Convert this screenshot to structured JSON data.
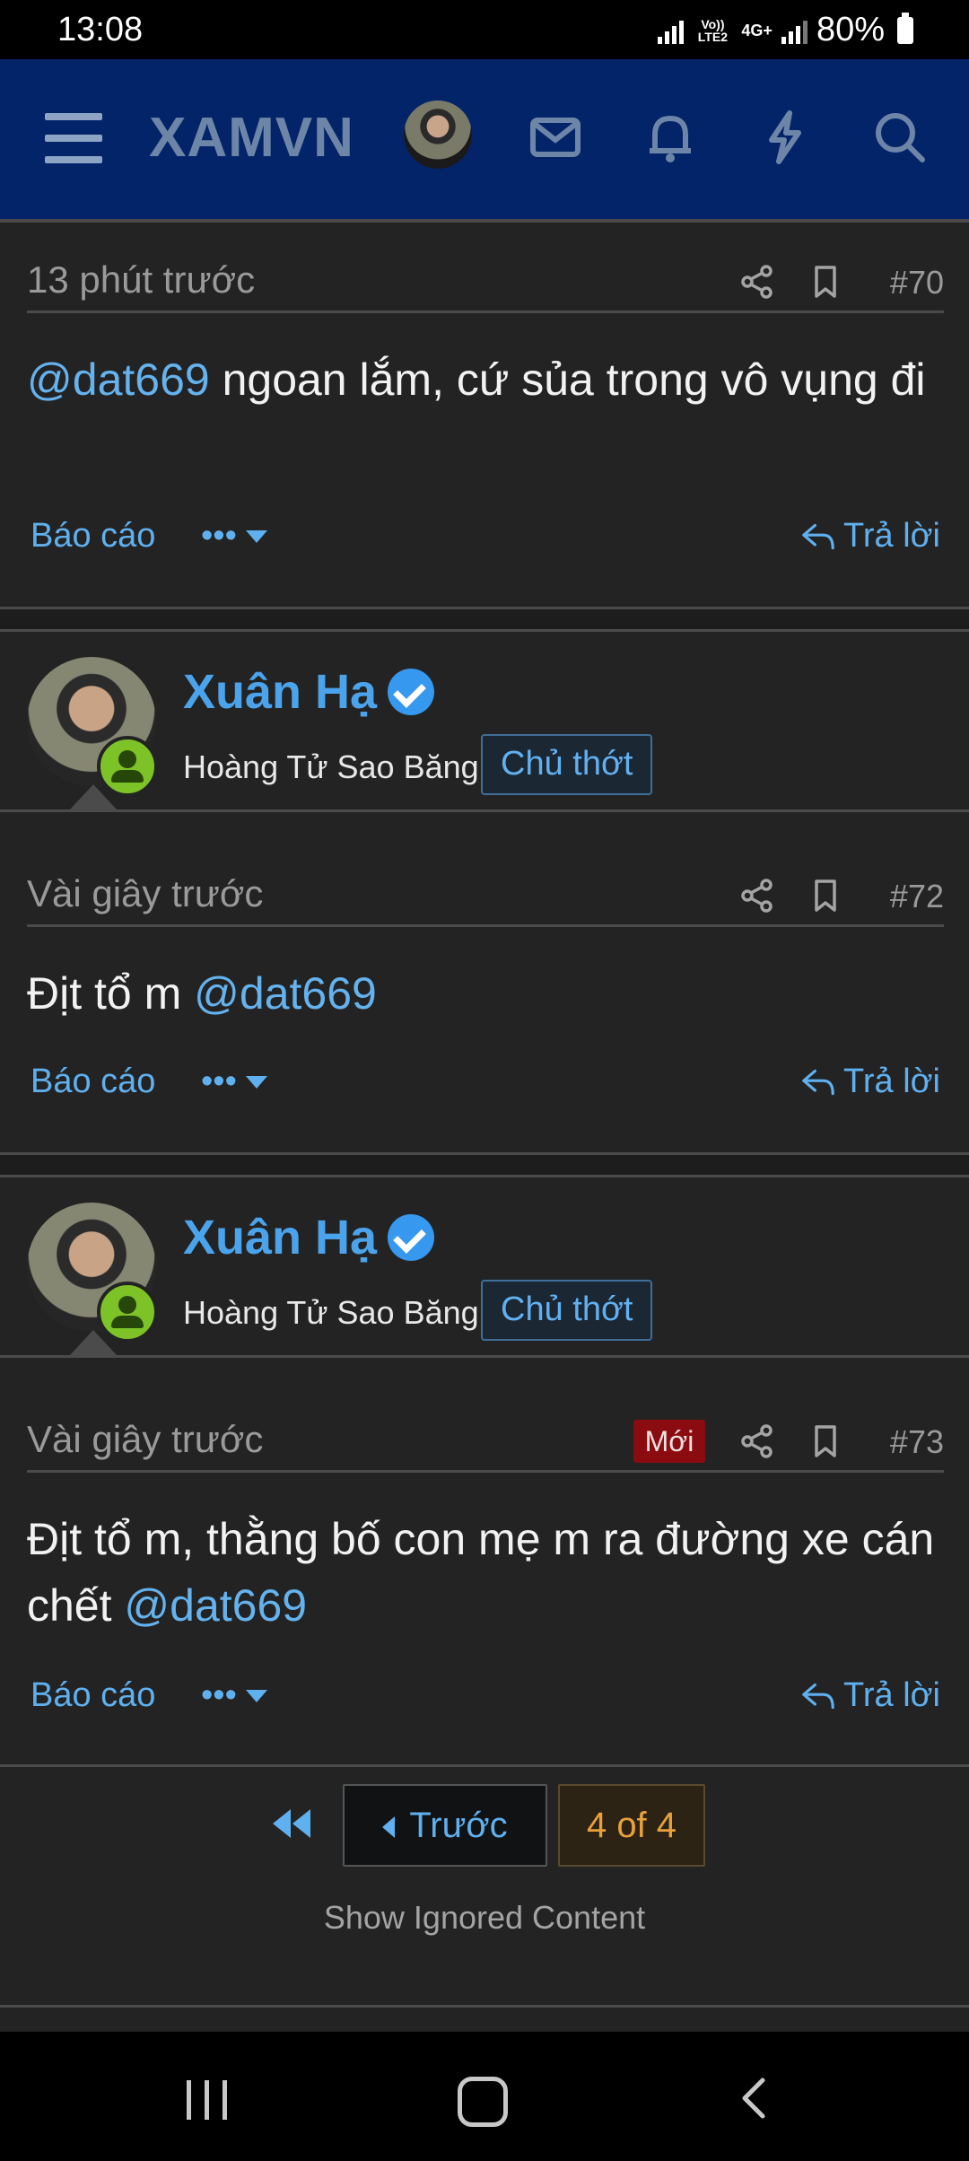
{
  "status_bar": {
    "time": "13:08",
    "network": "Vo)) LTE2",
    "net_type": "4G+",
    "battery": "80%"
  },
  "app_bar": {
    "logo": "XAMVN",
    "icons": [
      "menu-icon",
      "avatar",
      "mail-icon",
      "bell-icon",
      "bolt-icon",
      "search-icon"
    ]
  },
  "posts": [
    {
      "time": "13 phút trước",
      "number": "#70",
      "body_mention": "@dat669",
      "body_text": " ngoan lắm, cứ sủa trong vô vụng đi",
      "report": "Báo cáo",
      "reply": "Trả lời"
    },
    {
      "user": {
        "name": "Xuân Hạ",
        "title": "Hoàng Tử Sao Băng",
        "role": "Chủ thớt"
      },
      "time": "Vài giây trước",
      "number": "#72",
      "body_text": "Địt tổ m ",
      "body_mention": "@dat669",
      "report": "Báo cáo",
      "reply": "Trả lời"
    },
    {
      "user": {
        "name": "Xuân Hạ",
        "title": "Hoàng Tử Sao Băng",
        "role": "Chủ thớt"
      },
      "time": "Vài giây trước",
      "badge": "Mới",
      "number": "#73",
      "body_text": "Địt tổ m, thằng bố con mẹ m ra đường xe cán chết ",
      "body_mention": "@dat669",
      "report": "Báo cáo",
      "reply": "Trả lời"
    }
  ],
  "pagination": {
    "prev": "Trước",
    "current": "4 of 4"
  },
  "ignored": "Show Ignored Content",
  "colors": {
    "appbar": "#04246a",
    "link": "#5fb0ef",
    "background": "#232323",
    "new_badge": "#8b0c10",
    "online": "#7dc327"
  }
}
